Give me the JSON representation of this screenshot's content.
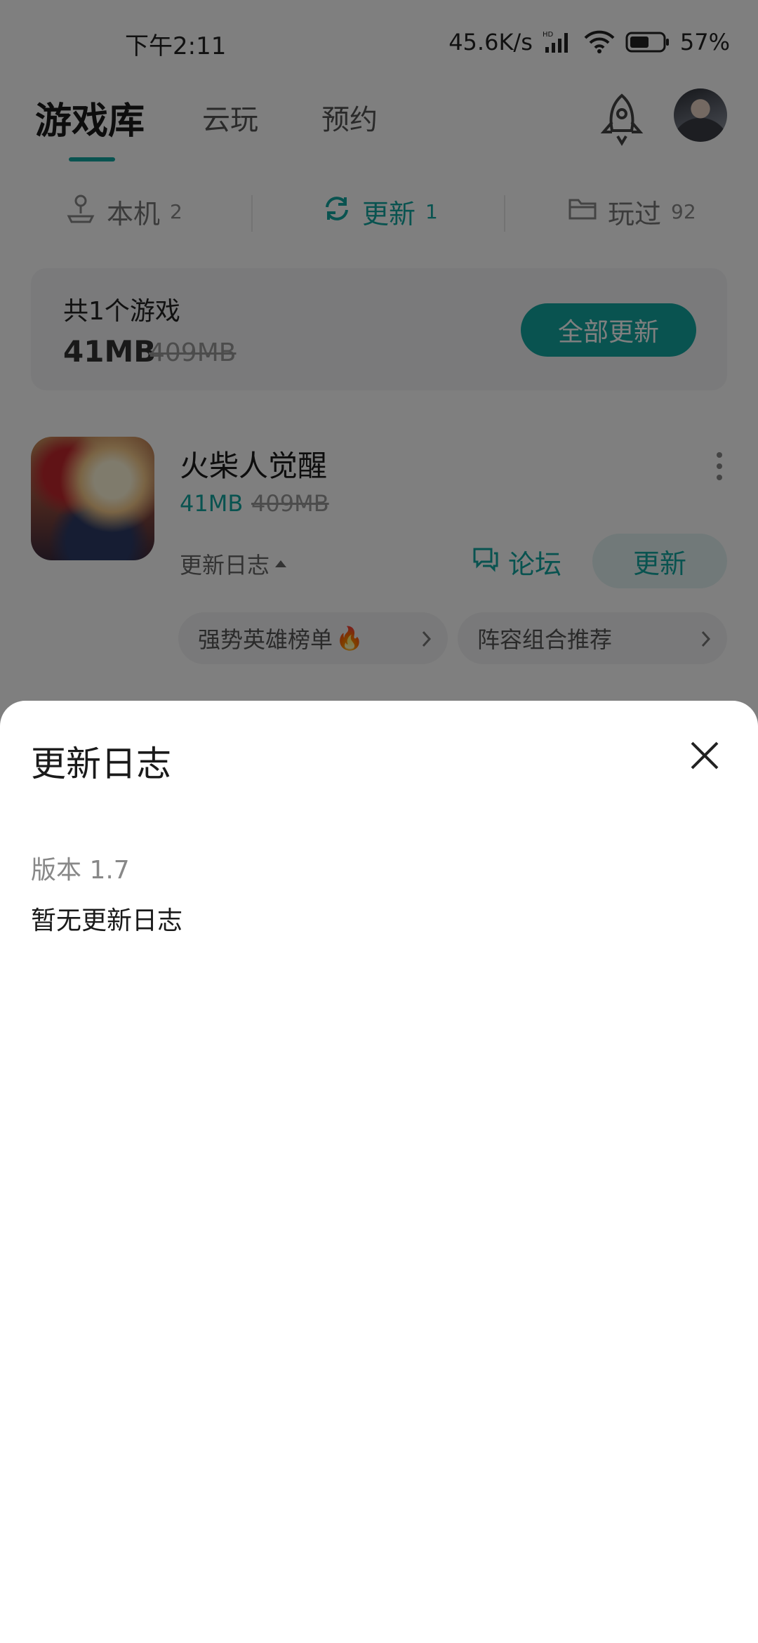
{
  "status_bar": {
    "time": "下午2:11",
    "net_speed": "45.6K/s",
    "battery": "57%"
  },
  "header": {
    "tabs": [
      {
        "label": "游戏库",
        "active": true
      },
      {
        "label": "云玩",
        "active": false
      },
      {
        "label": "预约",
        "active": false
      }
    ],
    "rocket_icon": "rocket-icon",
    "avatar": "user-avatar"
  },
  "subtabs": [
    {
      "label": "本机",
      "count": "2",
      "icon": "joystick-icon",
      "active": false
    },
    {
      "label": "更新",
      "count": "1",
      "icon": "refresh-icon",
      "active": true
    },
    {
      "label": "玩过",
      "count": "92",
      "icon": "folder-icon",
      "active": false
    }
  ],
  "summary": {
    "count_text": "共1个游戏",
    "size": "41MB",
    "original_size": "409MB",
    "update_all_label": "全部更新"
  },
  "game": {
    "name": "火柴人觉醒",
    "size": "41MB",
    "original_size": "409MB",
    "changelog_label": "更新日志",
    "forum_label": "论坛",
    "update_label": "更新",
    "chips": [
      {
        "label": "强势英雄榜单"
      },
      {
        "label": "阵容组合推荐"
      }
    ]
  },
  "sheet": {
    "title": "更新日志",
    "version": "版本 1.7",
    "content": "暂无更新日志"
  },
  "colors": {
    "accent": "#13a6a0",
    "scrim": "rgba(0,0,0,0.5)"
  }
}
